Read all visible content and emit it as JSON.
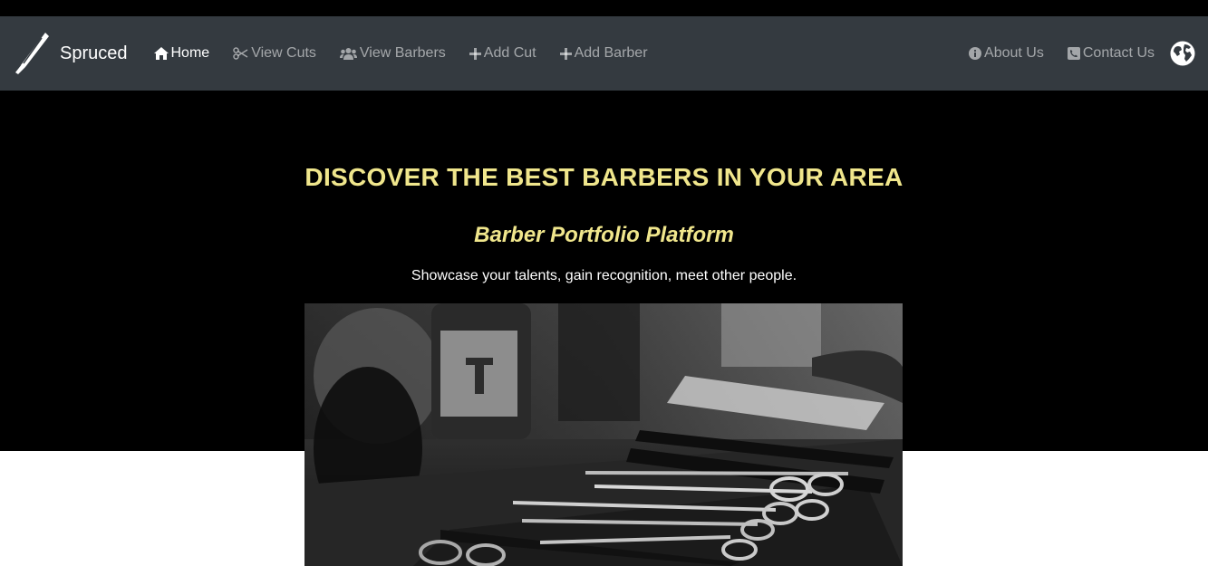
{
  "brand": {
    "name": "Spruced",
    "logo_icon": "razor-icon"
  },
  "nav": {
    "left": [
      {
        "label": "Home",
        "icon": "home-icon",
        "active": true
      },
      {
        "label": "View Cuts",
        "icon": "scissors-icon",
        "active": false
      },
      {
        "label": "View Barbers",
        "icon": "users-icon",
        "active": false
      },
      {
        "label": "Add Cut",
        "icon": "plus-icon",
        "active": false
      },
      {
        "label": "Add Barber",
        "icon": "plus-icon",
        "active": false
      }
    ],
    "right": [
      {
        "label": "About Us",
        "icon": "info-icon"
      },
      {
        "label": "Contact Us",
        "icon": "phone-icon"
      }
    ],
    "globe_icon": "globe-icon"
  },
  "hero": {
    "title": "DISCOVER THE BEST BARBERS IN YOUR AREA",
    "subtitle": "Barber Portfolio Platform",
    "text": "Showcase your talents, gain recognition, meet other people."
  },
  "colors": {
    "navbar": "#343a40",
    "hero_background": "#000000",
    "accent": "#f0e68c",
    "nav_text_inactive": "rgba(255,255,255,0.55)"
  }
}
